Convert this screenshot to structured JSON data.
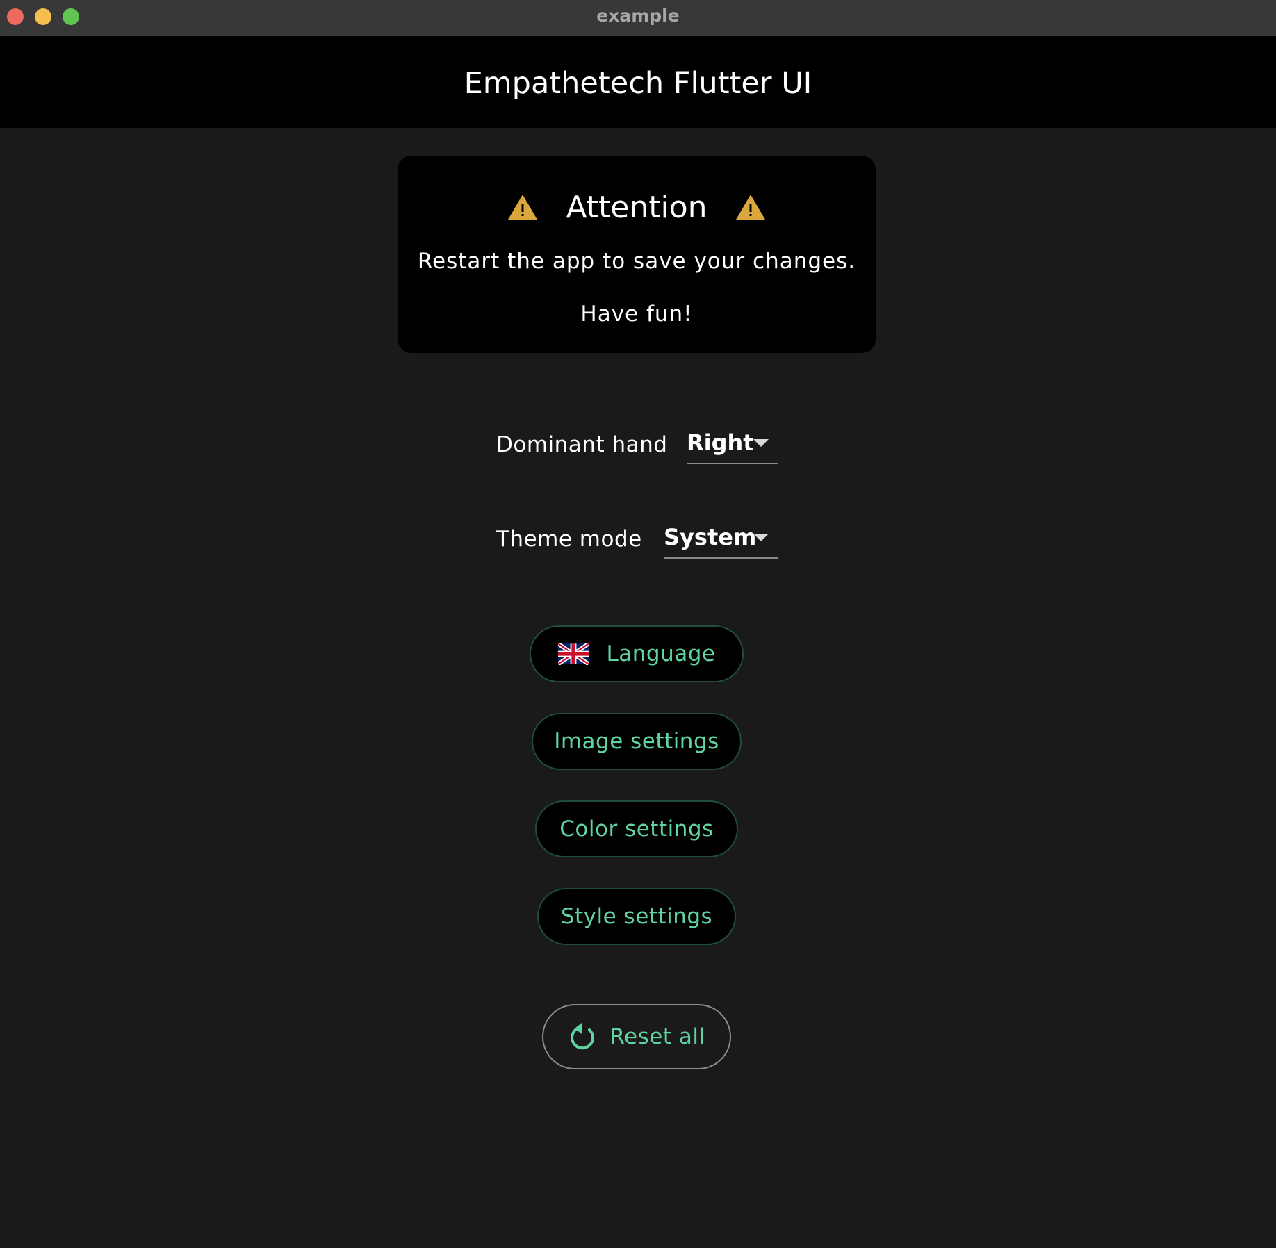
{
  "window": {
    "title": "example"
  },
  "appbar": {
    "title": "Empathetech Flutter UI"
  },
  "attention": {
    "title": "Attention",
    "message": "Restart the app to save your changes.",
    "footer": "Have fun!",
    "icon": "warning-icon",
    "icon_color": "#d9a73e"
  },
  "settings": {
    "dominant_hand": {
      "label": "Dominant hand",
      "value": "Right"
    },
    "theme_mode": {
      "label": "Theme mode",
      "value": "System"
    }
  },
  "buttons": {
    "language": {
      "label": "Language",
      "icon": "uk-flag-icon"
    },
    "image_settings": {
      "label": "Image settings"
    },
    "color_settings": {
      "label": "Color settings"
    },
    "style_settings": {
      "label": "Style settings"
    },
    "reset_all": {
      "label": "Reset all",
      "icon": "refresh-icon"
    }
  },
  "colors": {
    "background": "#1a1a1a",
    "appbar": "#000000",
    "accent": "#5fd4a2",
    "button_border": "#1f4d3f",
    "warning": "#d9a73e"
  }
}
